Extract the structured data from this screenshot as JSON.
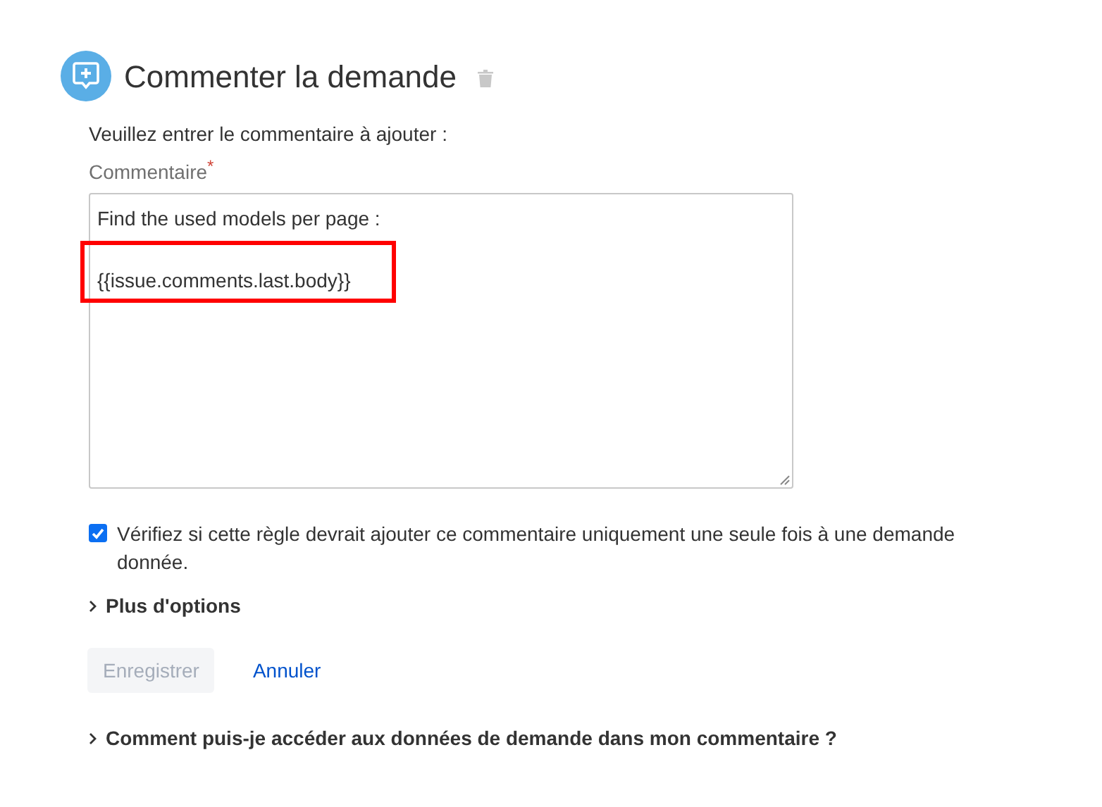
{
  "title": "Commenter la demande",
  "intro": "Veuillez entrer le commentaire à ajouter :",
  "field": {
    "label": "Commentaire",
    "required_mark": "*",
    "paragraphs": [
      "Find the used models per page :",
      "{{issue.comments.last.body}}"
    ]
  },
  "checkbox": {
    "label": "Vérifiez si cette règle devrait ajouter ce commentaire uniquement une seule fois à une demande donnée.",
    "checked": true
  },
  "more_options": {
    "label": "Plus d'options",
    "expanded": false
  },
  "buttons": [
    {
      "label": "Enregistrer",
      "kind": "primary",
      "disabled": true
    },
    {
      "label": "Annuler",
      "kind": "link",
      "disabled": false
    }
  ],
  "help": {
    "label": "Comment puis-je accéder aux données de demande dans mon commentaire ?",
    "expanded": false
  }
}
